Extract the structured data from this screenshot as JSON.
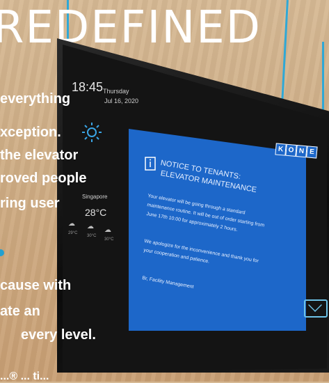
{
  "headline": "REDEFINED",
  "screen": {
    "time": "18:45",
    "day": "Thursday",
    "date": "Jul 16, 2020",
    "location": "Singapore",
    "temperature": "28°C",
    "forecast": [
      "29°C",
      "30°C",
      "30°C"
    ],
    "notice": {
      "title_line1": "NOTICE TO TENANTS:",
      "title_line2": "ELEVATOR MAINTENANCE",
      "body": [
        "Your elevator will be going through a standard",
        "maintenance routine. It will be out of order starting from",
        "June 17th 10:00 for approximately 2 hours.",
        "We apologize for the inconvenience and thank you for",
        "your cooperation and patience.",
        "Br, Facility Management"
      ]
    },
    "brand": [
      "K",
      "O",
      "N",
      "E"
    ]
  },
  "body_lines": [
    "everything",
    "xception.",
    "the elevator",
    "roved people",
    "ring user",
    "cause with",
    "ate an",
    "every level."
  ],
  "footer_text": "...® ... ti..."
}
